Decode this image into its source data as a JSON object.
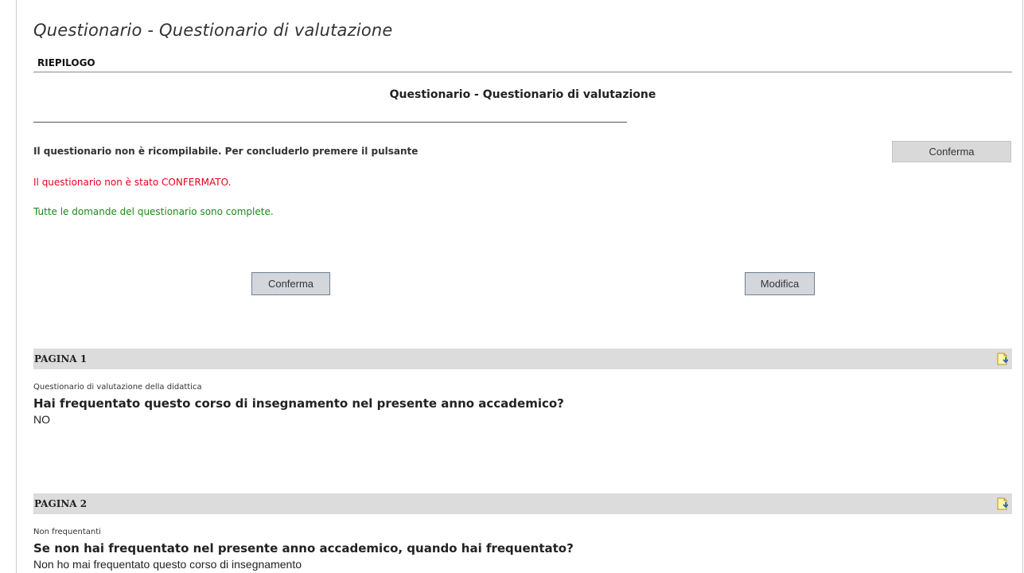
{
  "header": {
    "app_title": "Questionario - Questionario di valutazione",
    "tab_label": "RIEPILOGO"
  },
  "summary": {
    "title": "Questionario - Questionario di valutazione",
    "notice": "Il questionario non è ricompilabile. Per concluderlo premere il pulsante",
    "confirm_top_label": "Conferma",
    "status_not_confirmed": "Il questionario non è stato CONFERMATO.",
    "status_complete": "Tutte le domande del questionario sono complete.",
    "confirm_label": "Conferma",
    "modify_label": "Modifica"
  },
  "pages": [
    {
      "label": "PAGINA 1",
      "section": "Questionario di valutazione della didattica",
      "question": "Hai frequentato questo corso di insegnamento nel presente anno accademico?",
      "answer": "NO",
      "icon": "page-edit-icon"
    },
    {
      "label": "PAGINA 2",
      "section": "Non frequentanti",
      "question": "Se non hai frequentato nel presente anno accademico, quando hai frequentato?",
      "answer": "Non ho mai frequentato questo corso di insegnamento",
      "icon": "page-edit-icon"
    }
  ],
  "colors": {
    "status_red": "#e8001c",
    "status_green": "#1a8a1a",
    "page_bar": "#dcdcdc"
  }
}
